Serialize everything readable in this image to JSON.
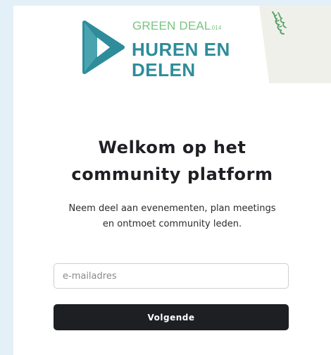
{
  "logo": {
    "line1": "GREEN DEAL",
    "line1_suffix": "014",
    "line2": "HUREN EN",
    "line3": "DELEN",
    "green_color": "#79c383",
    "teal_color": "#2e8c9b",
    "icon": "play-triangle-logo"
  },
  "partner_logo": {
    "icon": "flemish-lion-icon"
  },
  "heading": {
    "line1": "Welkom op het",
    "line2": "community platform"
  },
  "subtitle": {
    "line1": "Neem deel aan evenementen, plan meetings",
    "line2": "en ontmoet community leden."
  },
  "form": {
    "email_placeholder": "e-mailadres",
    "email_value": "",
    "submit_label": "Volgende",
    "button_color": "#1d1f22"
  },
  "colors": {
    "page_background": "#e3f0f8",
    "card_background": "#ffffff",
    "corner_panel": "#f0f0ea"
  }
}
